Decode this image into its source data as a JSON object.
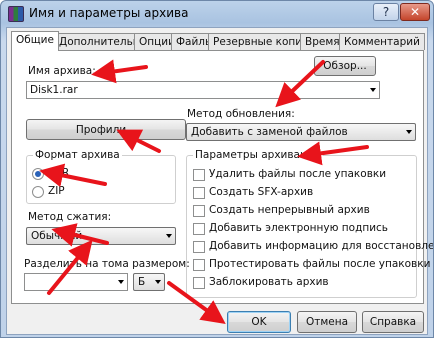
{
  "window": {
    "title": "Имя и параметры архива",
    "help_glyph": "?",
    "close_glyph": "✕"
  },
  "tabs": [
    {
      "label": "Общие"
    },
    {
      "label": "Дополнительно"
    },
    {
      "label": "Опции"
    },
    {
      "label": "Файлы"
    },
    {
      "label": "Резервные копии"
    },
    {
      "label": "Время"
    },
    {
      "label": "Комментарий"
    }
  ],
  "archive_name": {
    "label": "Имя архива:",
    "value": "Disk1.rar",
    "browse_label": "Обзор..."
  },
  "update_method": {
    "label": "Метод обновления:",
    "value": "Добавить с заменой файлов"
  },
  "profiles_label": "Профили...",
  "archive_format": {
    "label": "Формат архива",
    "options": [
      {
        "label": "RAR",
        "selected": true
      },
      {
        "label": "ZIP",
        "selected": false
      }
    ]
  },
  "compression_method": {
    "label": "Метод сжатия:",
    "value": "Обычный"
  },
  "split_volumes": {
    "label": "Разделить на тома размером:",
    "value": "",
    "unit": "Б"
  },
  "archive_options": {
    "label": "Параметры архивации",
    "items": [
      {
        "label": "Удалить файлы после упаковки",
        "checked": false
      },
      {
        "label": "Создать SFX-архив",
        "checked": false
      },
      {
        "label": "Создать непрерывный архив",
        "checked": false
      },
      {
        "label": "Добавить электронную подпись",
        "checked": false
      },
      {
        "label": "Добавить информацию для восстановления",
        "checked": false
      },
      {
        "label": "Протестировать файлы после упаковки",
        "checked": false
      },
      {
        "label": "Заблокировать архив",
        "checked": false
      }
    ]
  },
  "buttons": {
    "ok": "OK",
    "cancel": "Отмена",
    "help": "Справка"
  },
  "colors": {
    "annotation_arrow": "#e8141b",
    "radio_dot": "#2a62b8"
  }
}
